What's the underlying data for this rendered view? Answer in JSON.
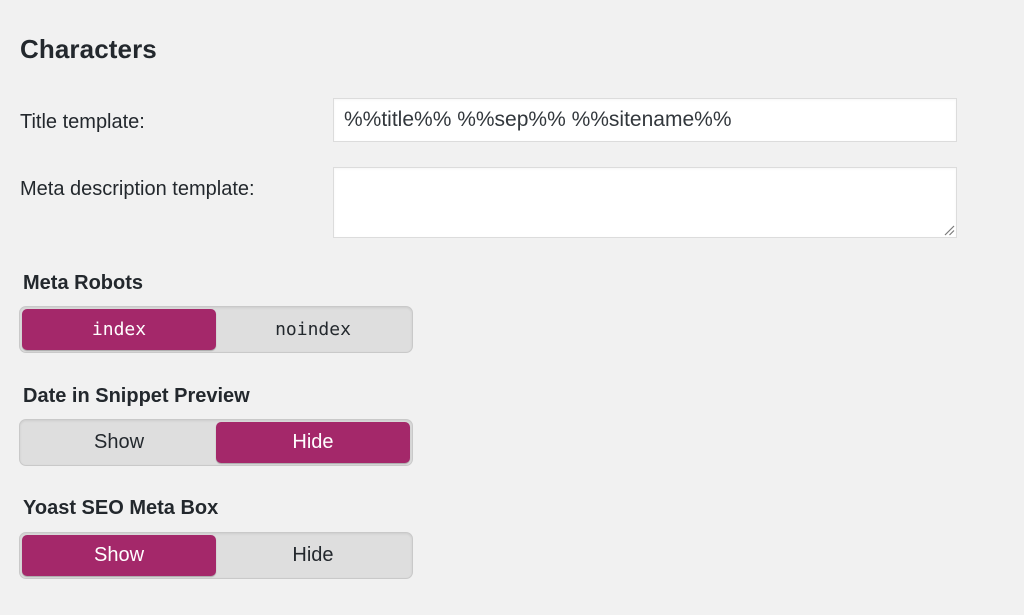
{
  "section": {
    "title": "Characters"
  },
  "fields": {
    "title_template": {
      "label": "Title template:",
      "value": "%%title%% %%sep%% %%sitename%%"
    },
    "meta_description_template": {
      "label": "Meta description template:",
      "value": ""
    }
  },
  "toggles": {
    "meta_robots": {
      "heading": "Meta Robots",
      "options": [
        "index",
        "noindex"
      ],
      "selected": "index"
    },
    "date_in_snippet_preview": {
      "heading": "Date in Snippet Preview",
      "options": [
        "Show",
        "Hide"
      ],
      "selected": "Hide"
    },
    "yoast_seo_meta_box": {
      "heading": "Yoast SEO Meta Box",
      "options": [
        "Show",
        "Hide"
      ],
      "selected": "Show"
    }
  },
  "colors": {
    "accent": "#a4286a",
    "background": "#f1f1f1",
    "switch_track": "#dedede",
    "text": "#23282d"
  },
  "icons": {
    "textarea_resize": "resize-grip-icon"
  }
}
